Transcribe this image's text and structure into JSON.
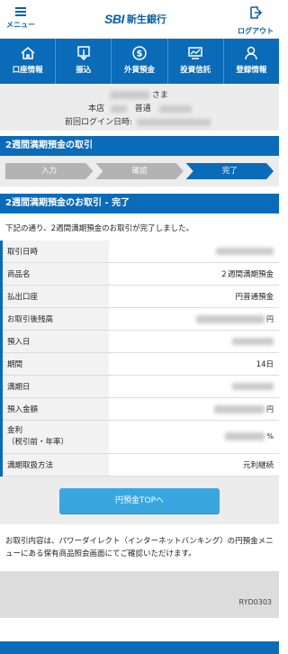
{
  "header": {
    "menu_label": "メニュー",
    "logo_sbi": "SBI",
    "logo_bank": "新生銀行",
    "logout_label": "ログアウト"
  },
  "nav": [
    {
      "label": "口座情報",
      "icon": "home-icon"
    },
    {
      "label": "振込",
      "icon": "transfer-icon"
    },
    {
      "label": "外貨預金",
      "icon": "dollar-icon"
    },
    {
      "label": "投資信託",
      "icon": "investment-icon"
    },
    {
      "label": "登録情報",
      "icon": "person-icon"
    }
  ],
  "user": {
    "honorific": "さま",
    "branch_label": "本店",
    "account_type": "普通",
    "last_login_label": "前回ログイン日時:"
  },
  "transaction_section_title": "2週間満期預金の取引",
  "steps": [
    "入力",
    "確認",
    "完了"
  ],
  "result_section_title": "2週間満期預金のお取引 - 完了",
  "intro_text": "下記の通り、2週間満期預金のお取引が完了しました。",
  "details": [
    {
      "label": "取引日時",
      "value": ""
    },
    {
      "label": "商品名",
      "value": "２週間満期預金"
    },
    {
      "label": "払出口座",
      "value": "円普通預金"
    },
    {
      "label": "お取引後残高",
      "value": "",
      "unit": "円"
    },
    {
      "label": "預入日",
      "value": ""
    },
    {
      "label": "期間",
      "value": "14日"
    },
    {
      "label": "満期日",
      "value": ""
    },
    {
      "label": "預入金額",
      "value": "",
      "unit": "円"
    },
    {
      "label": "金利\n（税引前・年率）",
      "value": "",
      "unit": "%"
    },
    {
      "label": "満期取扱方法",
      "value": "元利継続"
    }
  ],
  "top_button_label": "円預金TOPへ",
  "note_text": "お取引内容は、パワーダイレクト（インターネットバンキング）の円預金メニューにある保有商品照会画面にてご確認いただけます。",
  "screen_code": "RYD0303",
  "colors": {
    "primary": "#0a6bb8",
    "button": "#3aa6df",
    "logo_accent": "#d71920"
  }
}
